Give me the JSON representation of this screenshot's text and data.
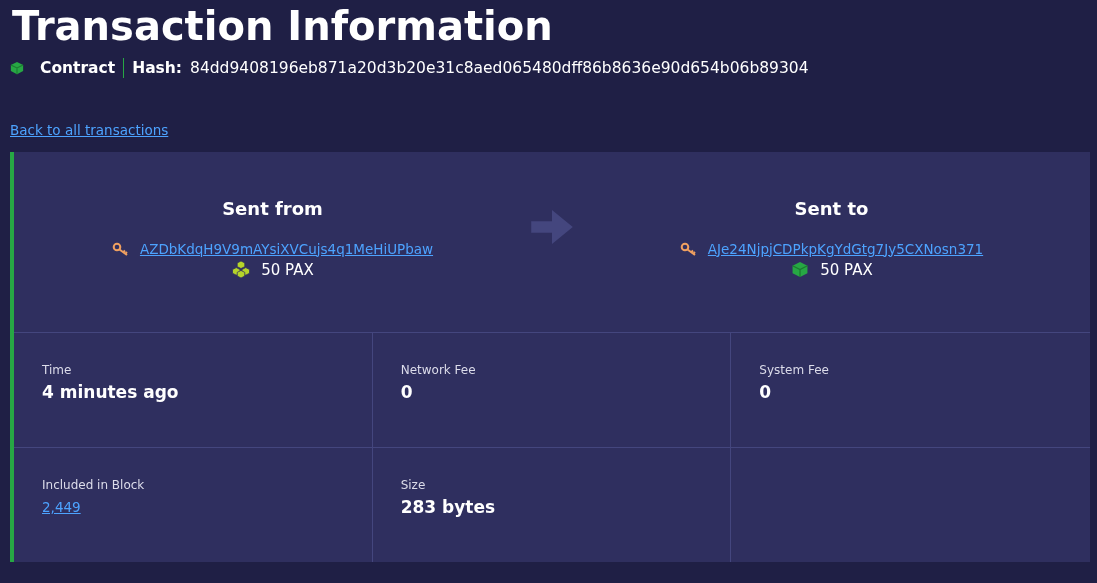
{
  "title": "Transaction Information",
  "type": {
    "label": "Contract",
    "hash_label": "Hash:",
    "hash": "84dd9408196eb871a20d3b20e31c8aed065480dff86b8636e90d654b06b89304"
  },
  "back_link": "Back to all transactions",
  "transfer": [
    {
      "heading": "Sent from",
      "address": "AZDbKdqH9V9mAYsiXVCujs4q1MeHiUPbaw",
      "amount": "50 PAX",
      "kind": "multi"
    },
    {
      "heading": "Sent to",
      "address": "AJe24NjpjCDPkpKgYdGtg7Jy5CXNosn371",
      "amount": "50 PAX",
      "kind": "single"
    }
  ],
  "details": [
    {
      "label": "Time",
      "value": "4 minutes ago",
      "kind": "text"
    },
    {
      "label": "Network Fee",
      "value": "0",
      "kind": "text"
    },
    {
      "label": "System Fee",
      "value": "0",
      "kind": "text"
    },
    {
      "label": "Included in Block",
      "value": "2,449",
      "kind": "link"
    },
    {
      "label": "Size",
      "value": "283 bytes",
      "kind": "text"
    }
  ]
}
